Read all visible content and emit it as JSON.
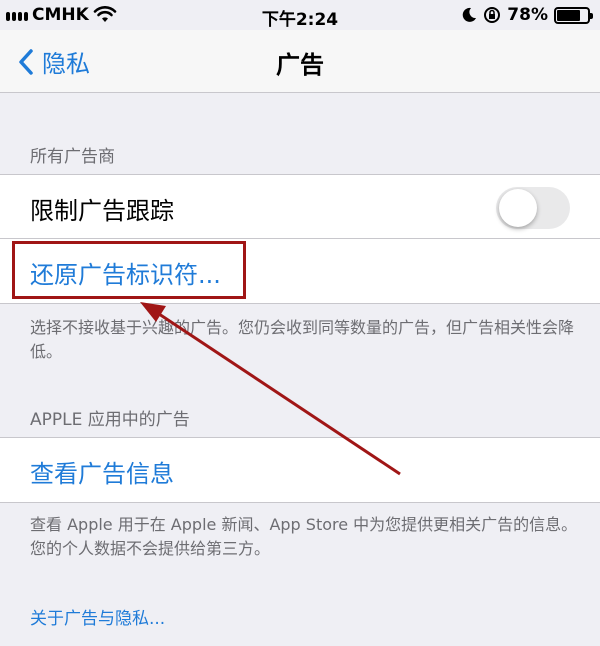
{
  "status_bar": {
    "carrier": "CMHK",
    "time": "下午2:24",
    "battery_percent": "78%",
    "battery_level": 0.78
  },
  "nav": {
    "back_label": "隐私",
    "title": "广告"
  },
  "section_all_advertisers": {
    "header": "所有广告商",
    "limit_tracking": {
      "label": "限制广告跟踪",
      "enabled": false
    },
    "reset_identifier": {
      "label": "还原广告标识符..."
    },
    "footer": "选择不接收基于兴趣的广告。您仍会收到同等数量的广告，但广告相关性会降低。"
  },
  "section_apple_apps": {
    "header": "APPLE 应用中的广告",
    "view_ad_info": {
      "label": "查看广告信息"
    },
    "footer": "查看 Apple 用于在 Apple 新闻、App Store 中为您提供更相关广告的信息。您的个人数据不会提供给第三方。"
  },
  "about_link": "关于广告与隐私...",
  "colors": {
    "accent": "#1f7bd8",
    "annotation": "#a01616",
    "background": "#efeff4"
  }
}
